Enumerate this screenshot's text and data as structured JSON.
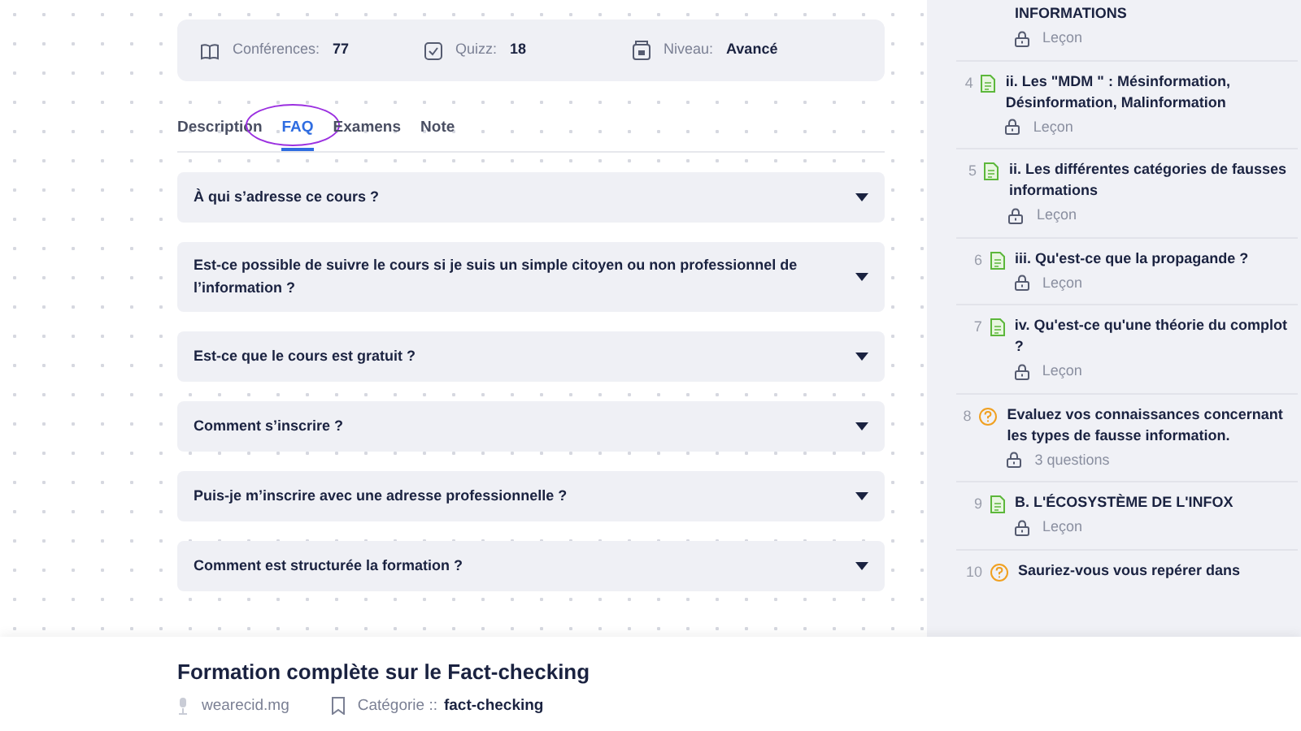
{
  "stats": [
    {
      "kind": "book",
      "label": "Conférences:",
      "value": "77"
    },
    {
      "kind": "quiz",
      "label": "Quizz:",
      "value": "18"
    },
    {
      "kind": "level",
      "label": "Niveau:",
      "value": "Avancé"
    }
  ],
  "tabs": [
    {
      "label": "Description",
      "selected": false
    },
    {
      "label": "FAQ",
      "selected": true
    },
    {
      "label": "Examens",
      "selected": false
    },
    {
      "label": "Note",
      "selected": false
    }
  ],
  "faq": [
    {
      "question": "À qui s’adresse ce cours ?"
    },
    {
      "question": "Est-ce possible de suivre le cours si je suis un simple citoyen ou non professionnel de l’information ?"
    },
    {
      "question": "Est-ce que le cours est gratuit ?"
    },
    {
      "question": "Comment s’inscrire ?"
    },
    {
      "question": "Puis-je m’inscrire avec une adresse professionnelle ?"
    },
    {
      "question": "Comment est structurée la formation ?"
    }
  ],
  "curriculum": [
    {
      "kind": "lesson",
      "title": "INFORMATIONS",
      "meta": "Leçon"
    },
    {
      "number": "4",
      "kind": "lesson",
      "title": "ii. Les \"MDM \" : Mésinformation, Désinformation, Malinformation",
      "meta": "Leçon"
    },
    {
      "number": "5",
      "kind": "lesson",
      "title": "ii. Les différentes catégories de fausses informations",
      "meta": "Leçon"
    },
    {
      "number": "6",
      "kind": "lesson",
      "title": "iii. Qu'est-ce que la propagande ?",
      "meta": "Leçon"
    },
    {
      "number": "7",
      "kind": "lesson",
      "title": "iv. Qu'est-ce qu'une théorie du complot ?",
      "meta": "Leçon"
    },
    {
      "number": "8",
      "kind": "quiz",
      "title": "Evaluez vos connaissances concernant les types de fausse information.",
      "meta": "3 questions"
    },
    {
      "number": "9",
      "kind": "lesson",
      "title": "B. L'ÉCOSYSTÈME DE L'INFOX",
      "meta": "Leçon"
    },
    {
      "number": "10",
      "kind": "quiz",
      "title": "Sauriez-vous vous repérer dans"
    }
  ],
  "footer": {
    "title": "Formation complète sur le Fact-checking",
    "author": "wearecid.mg",
    "category_label": "Catégorie ::",
    "category": "fact-checking"
  }
}
